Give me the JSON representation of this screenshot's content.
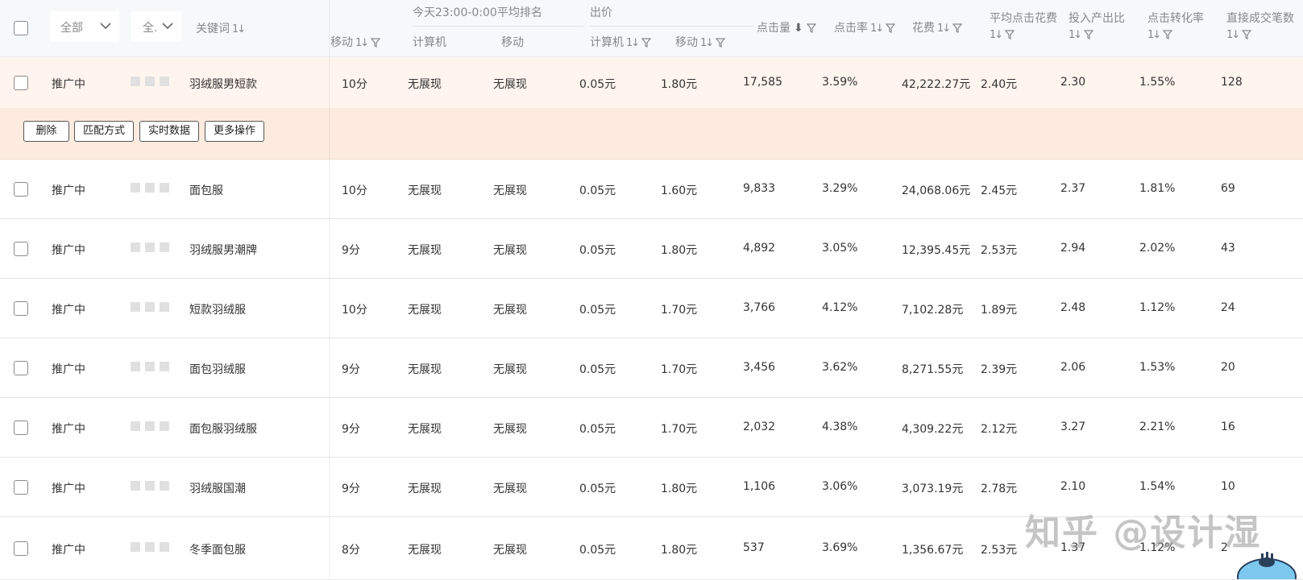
{
  "filters": {
    "status_select": "全部",
    "type_select": "全."
  },
  "headers": {
    "keyword": "关键词",
    "rank_group": "今天23:00-0:00平均排名",
    "bid_group": "出价",
    "mobile_quality": "移动",
    "rank_pc": "计算机",
    "rank_mobile": "移动",
    "bid_pc": "计算机",
    "bid_mobile": "移动",
    "clicks": "点击量",
    "ctr": "点击率",
    "cost": "花费",
    "avg_cpc_line1": "平均点击花费",
    "roi": "投入产出比",
    "cvr": "点击转化率",
    "orders": "直接成交笔数"
  },
  "actions": {
    "delete": "删除",
    "match": "匹配方式",
    "realtime": "实时数据",
    "more": "更多操作"
  },
  "rows": [
    {
      "status": "推广中",
      "keyword": "羽绒服男短款",
      "quality": "10分",
      "rank_pc": "无展现",
      "rank_mobile": "无展现",
      "bid_pc": "0.05元",
      "bid_mobile": "1.80元",
      "clicks": "17,585",
      "ctr": "3.59%",
      "cost": "42,222.27元",
      "cpc": "2.40元",
      "roi": "2.30",
      "cvr": "1.55%",
      "orders": "128"
    },
    {
      "status": "推广中",
      "keyword": "面包服",
      "quality": "10分",
      "rank_pc": "无展现",
      "rank_mobile": "无展现",
      "bid_pc": "0.05元",
      "bid_mobile": "1.60元",
      "clicks": "9,833",
      "ctr": "3.29%",
      "cost": "24,068.06元",
      "cpc": "2.45元",
      "roi": "2.37",
      "cvr": "1.81%",
      "orders": "69"
    },
    {
      "status": "推广中",
      "keyword": "羽绒服男潮牌",
      "quality": "9分",
      "rank_pc": "无展现",
      "rank_mobile": "无展现",
      "bid_pc": "0.05元",
      "bid_mobile": "1.80元",
      "clicks": "4,892",
      "ctr": "3.05%",
      "cost": "12,395.45元",
      "cpc": "2.53元",
      "roi": "2.94",
      "cvr": "2.02%",
      "orders": "43"
    },
    {
      "status": "推广中",
      "keyword": "短款羽绒服",
      "quality": "10分",
      "rank_pc": "无展现",
      "rank_mobile": "无展现",
      "bid_pc": "0.05元",
      "bid_mobile": "1.70元",
      "clicks": "3,766",
      "ctr": "4.12%",
      "cost": "7,102.28元",
      "cpc": "1.89元",
      "roi": "2.48",
      "cvr": "1.12%",
      "orders": "24"
    },
    {
      "status": "推广中",
      "keyword": "面包羽绒服",
      "quality": "9分",
      "rank_pc": "无展现",
      "rank_mobile": "无展现",
      "bid_pc": "0.05元",
      "bid_mobile": "1.70元",
      "clicks": "3,456",
      "ctr": "3.62%",
      "cost": "8,271.55元",
      "cpc": "2.39元",
      "roi": "2.06",
      "cvr": "1.53%",
      "orders": "20"
    },
    {
      "status": "推广中",
      "keyword": "面包服羽绒服",
      "quality": "9分",
      "rank_pc": "无展现",
      "rank_mobile": "无展现",
      "bid_pc": "0.05元",
      "bid_mobile": "1.70元",
      "clicks": "2,032",
      "ctr": "4.38%",
      "cost": "4,309.22元",
      "cpc": "2.12元",
      "roi": "3.27",
      "cvr": "2.21%",
      "orders": "16"
    },
    {
      "status": "推广中",
      "keyword": "羽绒服国潮",
      "quality": "9分",
      "rank_pc": "无展现",
      "rank_mobile": "无展现",
      "bid_pc": "0.05元",
      "bid_mobile": "1.80元",
      "clicks": "1,106",
      "ctr": "3.06%",
      "cost": "3,073.19元",
      "cpc": "2.78元",
      "roi": "2.10",
      "cvr": "1.54%",
      "orders": "10"
    },
    {
      "status": "推广中",
      "keyword": "冬季面包服",
      "quality": "8分",
      "rank_pc": "无展现",
      "rank_mobile": "无展现",
      "bid_pc": "0.05元",
      "bid_mobile": "1.80元",
      "clicks": "537",
      "ctr": "3.69%",
      "cost": "1,356.67元",
      "cpc": "2.53元",
      "roi": "1.37",
      "cvr": "1.12%",
      "orders": "2"
    }
  ],
  "watermark": "知乎 @设计湿",
  "colors": {
    "status_green": "#2e9a4a",
    "highlight_row": "#fff5ee",
    "action_row": "#fdebdf",
    "header_bg": "#f7f8fa"
  },
  "icons": [
    "checkbox",
    "chevron-down-icon",
    "sort-icon",
    "filter-icon",
    "sort-desc-icon",
    "mascot-icon"
  ]
}
